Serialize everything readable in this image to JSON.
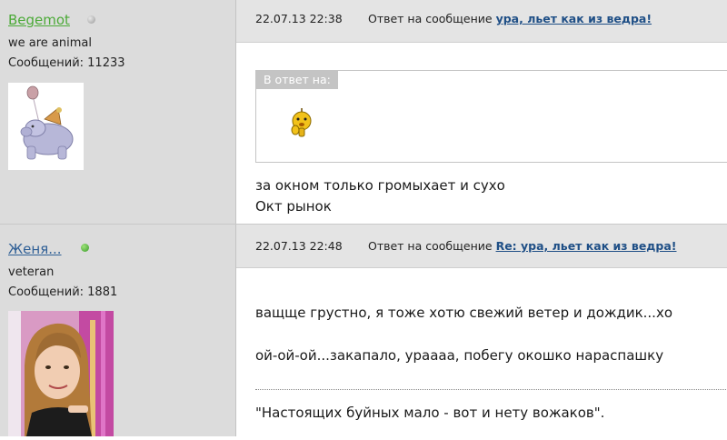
{
  "posts": [
    {
      "username": "Begemot",
      "online": false,
      "status": "we are animal",
      "message_count": "Сообщений: 11233",
      "date": "22.07.13 22:38",
      "reply_prefix": "Ответ на сообщение",
      "reply_title": "ура, льет как из ведра!",
      "quote_label": "В ответ на:",
      "lines": [
        "за окном только громыхает и сухо",
        "Окт рынок"
      ]
    },
    {
      "username": "Женя...",
      "online": true,
      "status": "veteran",
      "message_count": "Сообщений: 1881",
      "date": "22.07.13 22:48",
      "reply_prefix": "Ответ на сообщение",
      "reply_title": "Re: ура, льет как из ведра!",
      "lines": [
        "ващще грустно, я тоже хотю свежий ветер и дождик...хо",
        "ой-ой-ой...закапало, урaааа, побегу окошко нараспашку"
      ],
      "signature": "\"Настоящих буйных мало - вот и нету вожаков\"."
    }
  ],
  "colors": {
    "online": "#3a9c2a",
    "offline": "#999999",
    "link": "#1f4f86",
    "username_1": "#4caa38",
    "username_2": "#2f5f96"
  },
  "icons": {
    "online_dot": "status-online-icon",
    "offline_dot": "status-offline-icon",
    "smiley": "smiley-icon"
  }
}
